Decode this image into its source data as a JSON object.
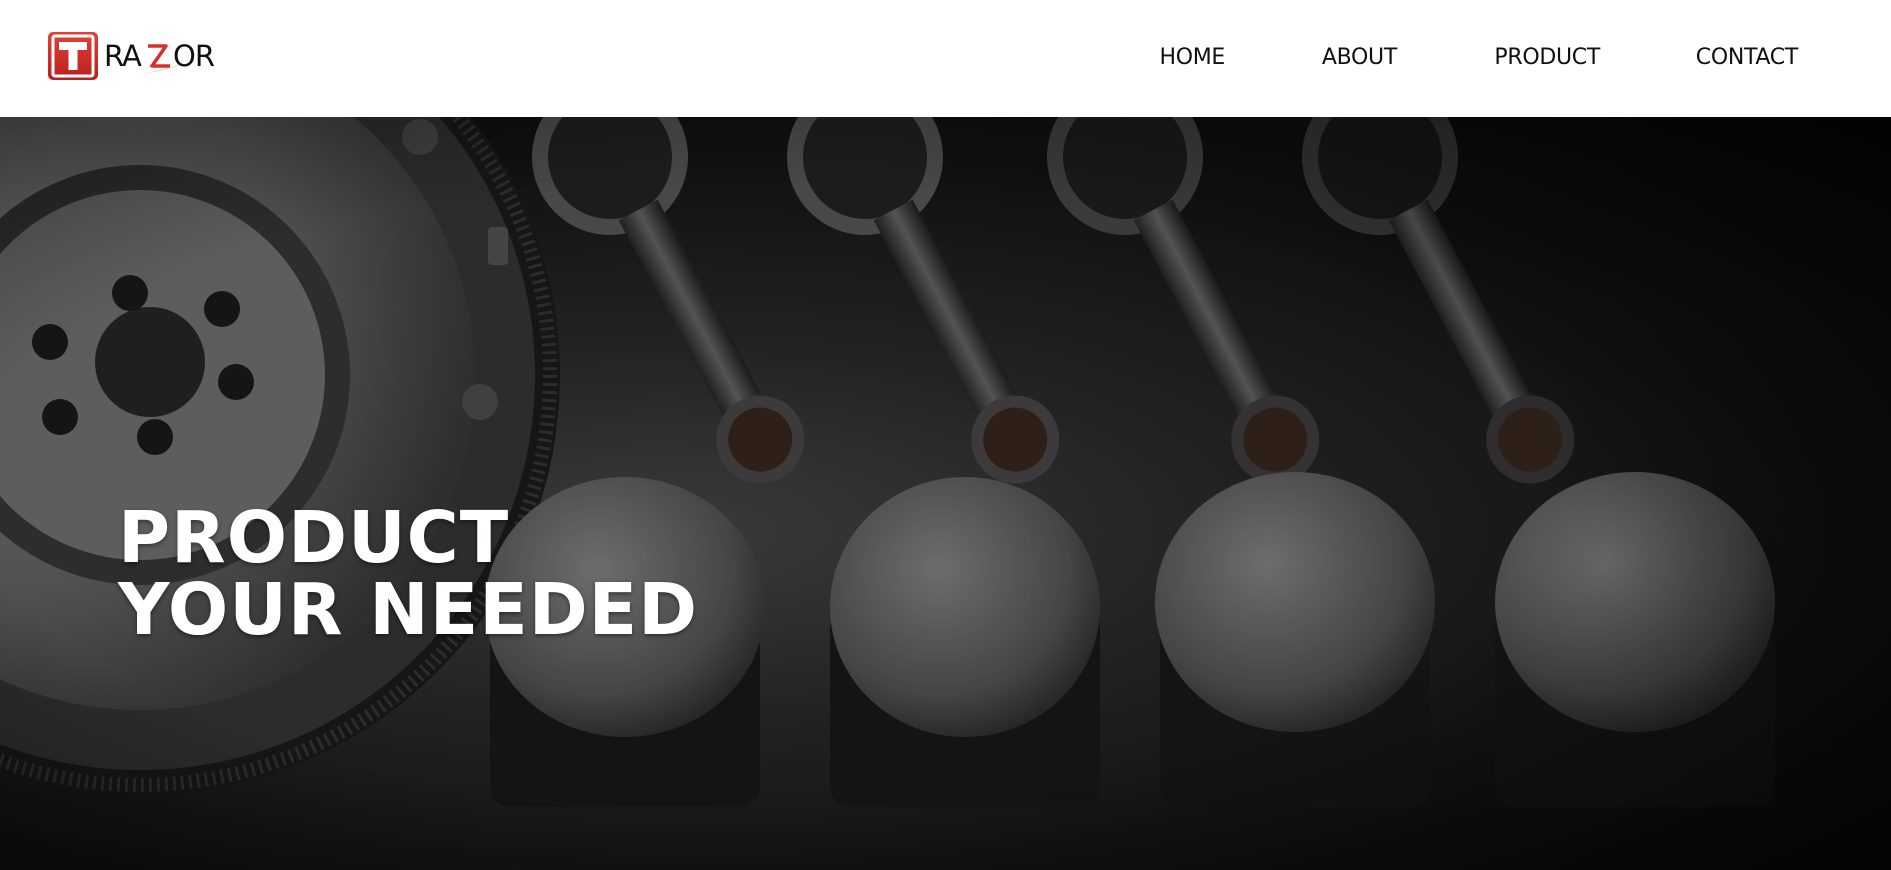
{
  "header": {
    "logo": {
      "mark_letter": "T",
      "wordmark": "RAZOR"
    },
    "nav": [
      {
        "label": "HOME"
      },
      {
        "label": "ABOUT"
      },
      {
        "label": "PRODUCT"
      },
      {
        "label": "CONTACT"
      }
    ]
  },
  "hero": {
    "title_line1": "PRODUCT",
    "title_line2": "YOUR NEEDED"
  },
  "colors": {
    "brand_red": "#d6302b",
    "brand_orange": "#f08a1e",
    "nav_text": "#111111",
    "hero_text": "#ffffff",
    "header_bg": "#ffffff"
  }
}
